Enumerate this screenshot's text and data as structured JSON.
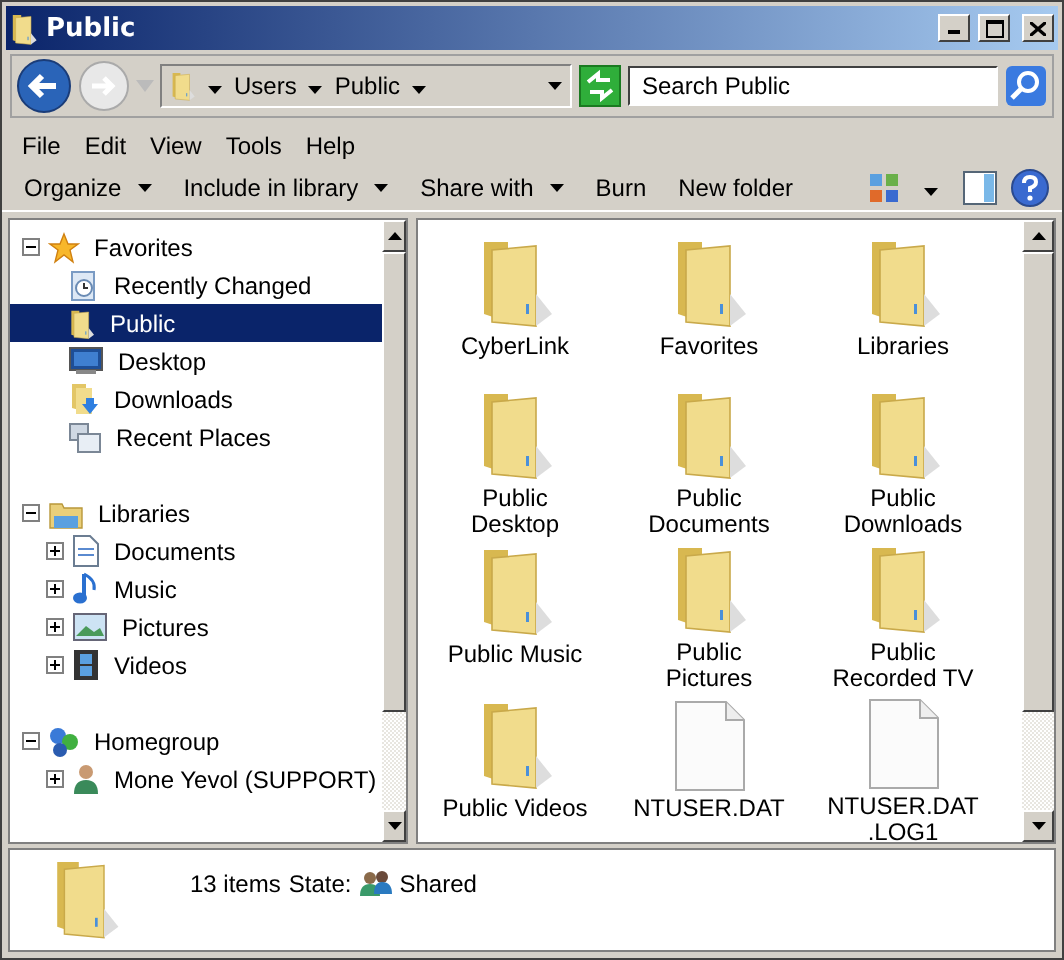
{
  "window": {
    "title": "Public"
  },
  "address": {
    "crumbs": [
      "Users",
      "Public"
    ],
    "search_placeholder": "Search Public"
  },
  "menu": [
    "File",
    "Edit",
    "View",
    "Tools",
    "Help"
  ],
  "toolbar": [
    {
      "label": "Organize",
      "dropdown": true
    },
    {
      "label": "Include in library",
      "dropdown": true
    },
    {
      "label": "Share with",
      "dropdown": true
    },
    {
      "label": "Burn",
      "dropdown": false
    },
    {
      "label": "New folder",
      "dropdown": false
    }
  ],
  "nav": [
    {
      "label": "Favorites",
      "expanded": true,
      "children": [
        {
          "label": "Recently Changed",
          "selected": false
        },
        {
          "label": "Public",
          "selected": true
        },
        {
          "label": "Desktop",
          "selected": false
        },
        {
          "label": "Downloads",
          "selected": false
        },
        {
          "label": "Recent Places",
          "selected": false
        }
      ]
    },
    {
      "label": "Libraries",
      "expanded": true,
      "children": [
        {
          "label": "Documents",
          "selected": false,
          "expandable": true
        },
        {
          "label": "Music",
          "selected": false,
          "expandable": true
        },
        {
          "label": "Pictures",
          "selected": false,
          "expandable": true
        },
        {
          "label": "Videos",
          "selected": false,
          "expandable": true
        }
      ]
    },
    {
      "label": "Homegroup",
      "expanded": true,
      "children": [
        {
          "label": "Mone Yevol (SUPPORT)",
          "selected": false,
          "expandable": true
        }
      ]
    }
  ],
  "files": [
    {
      "name": "CyberLink",
      "kind": "folder"
    },
    {
      "name": "Favorites",
      "kind": "folder"
    },
    {
      "name": "Libraries",
      "kind": "folder"
    },
    {
      "name": "Public Desktop",
      "kind": "folder"
    },
    {
      "name": "Public Documents",
      "kind": "folder"
    },
    {
      "name": "Public Downloads",
      "kind": "folder"
    },
    {
      "name": "Public Music",
      "kind": "folder"
    },
    {
      "name": "Public Pictures",
      "kind": "folder"
    },
    {
      "name": "Public Recorded TV",
      "kind": "folder"
    },
    {
      "name": "Public Videos",
      "kind": "folder"
    },
    {
      "name": "NTUSER.DAT",
      "kind": "file"
    },
    {
      "name": "NTUSER.DAT .LOG1",
      "kind": "file"
    }
  ],
  "details": {
    "count": "13 items",
    "state_label": "State:",
    "state": "Shared"
  }
}
